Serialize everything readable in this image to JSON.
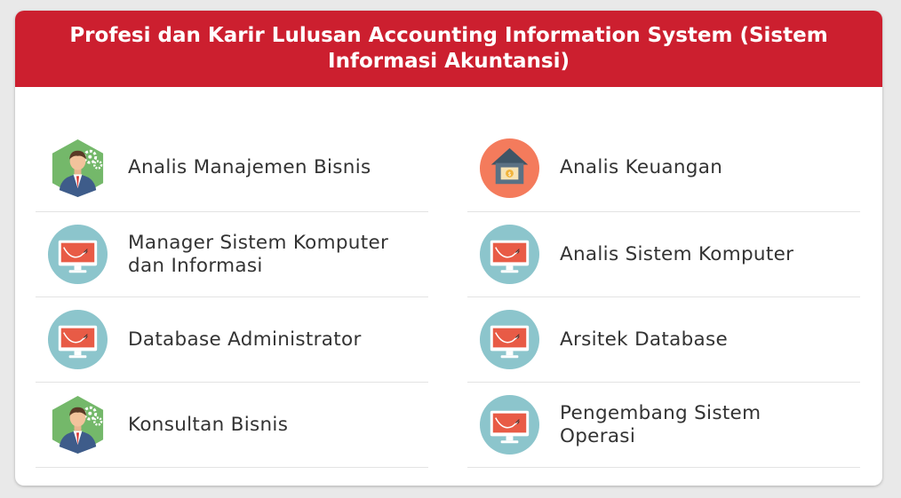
{
  "title": "Profesi dan Karir Lulusan Accounting Information System (Sistem Informasi Akuntansi)",
  "left_items": [
    {
      "label": "Analis Manajemen Bisnis",
      "icon": "businessman-gears-icon"
    },
    {
      "label": "Manager Sistem Komputer\ndan Informasi",
      "icon": "computer-monitor-icon"
    },
    {
      "label": "Database Administrator",
      "icon": "computer-monitor-icon"
    },
    {
      "label": "Konsultan Bisnis",
      "icon": "businessman-gears-icon"
    }
  ],
  "right_items": [
    {
      "label": "Analis Keuangan",
      "icon": "house-money-icon"
    },
    {
      "label": "Analis Sistem Komputer",
      "icon": "computer-monitor-icon"
    },
    {
      "label": "Arsitek Database",
      "icon": "computer-monitor-icon"
    },
    {
      "label": "Pengembang Sistem\nOperasi",
      "icon": "computer-monitor-icon"
    }
  ],
  "colors": {
    "header_bg": "#cc1f2f",
    "monitor_circle": "#8cc5cc",
    "businessman_hexagon": "#74b86a",
    "house_circle": "#f47b5c"
  }
}
